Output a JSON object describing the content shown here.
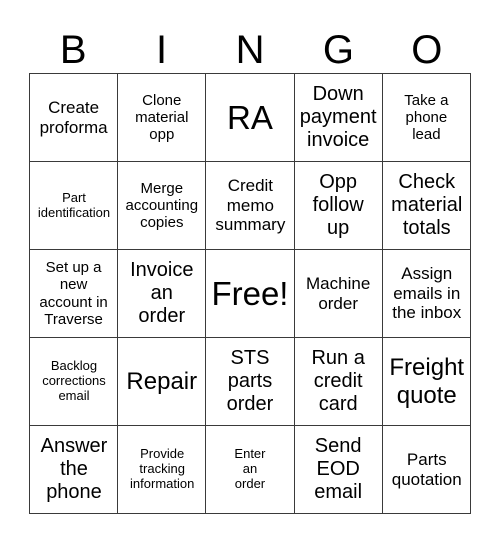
{
  "header": {
    "letters": [
      "B",
      "I",
      "N",
      "G",
      "O"
    ]
  },
  "board": {
    "rows": [
      [
        {
          "text": "Create proforma"
        },
        {
          "text": "Clone material opp"
        },
        {
          "text": "RA"
        },
        {
          "text": "Down payment invoice"
        },
        {
          "text": "Take a phone lead"
        }
      ],
      [
        {
          "text": "Part identification"
        },
        {
          "text": "Merge accounting copies"
        },
        {
          "text": "Credit memo summary"
        },
        {
          "text": "Opp follow up"
        },
        {
          "text": "Check material totals"
        }
      ],
      [
        {
          "text": "Set up a new account in Traverse"
        },
        {
          "text": "Invoice an order"
        },
        {
          "text": "Free!"
        },
        {
          "text": "Machine order"
        },
        {
          "text": "Assign emails in the inbox"
        }
      ],
      [
        {
          "text": "Backlog corrections email"
        },
        {
          "text": "Repair"
        },
        {
          "text": "STS parts order"
        },
        {
          "text": "Run a credit card"
        },
        {
          "text": "Freight quote"
        }
      ],
      [
        {
          "text": "Answer the phone"
        },
        {
          "text": "Provide tracking information"
        },
        {
          "text": "Enter an order"
        },
        {
          "text": "Send EOD email"
        },
        {
          "text": "Parts quotation"
        }
      ]
    ]
  }
}
